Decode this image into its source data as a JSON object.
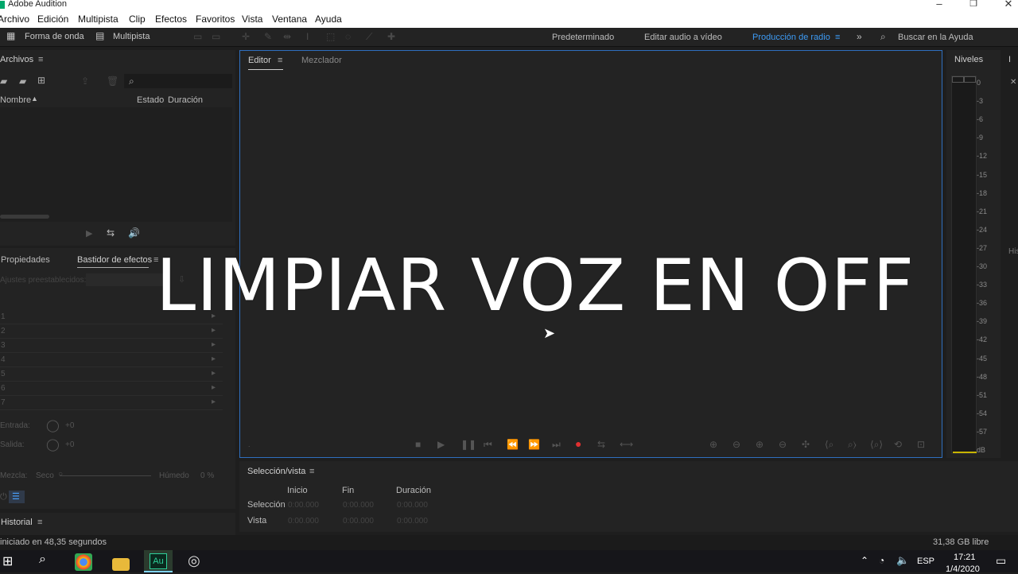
{
  "window": {
    "title": "Adobe Audition"
  },
  "menu": [
    "Archivo",
    "Edición",
    "Multipista",
    "Clip",
    "Efectos",
    "Favoritos",
    "Vista",
    "Ventana",
    "Ayuda"
  ],
  "toolbar": {
    "waveform": "Forma de onda",
    "multitrack": "Multipista",
    "workspaces": [
      "Predeterminado",
      "Editar audio a vídeo",
      "Producción de radio"
    ],
    "search_placeholder": "Buscar en la Ayuda"
  },
  "files_panel": {
    "title": "Archivos",
    "col_name": "Nombre",
    "col_status": "Estado",
    "col_duration": "Duración"
  },
  "effects_panel": {
    "tab_properties": "Propiedades",
    "tab_rack": "Bastidor de efectos",
    "presets_label": "Ajustes preestablecidos:",
    "slots": [
      "1",
      "2",
      "3",
      "4",
      "5",
      "6",
      "7"
    ],
    "input_label": "Entrada:",
    "output_label": "Salida:",
    "input_value": "+0",
    "output_value": "+0",
    "mix_label": "Mezcla:",
    "dry_label": "Seco",
    "wet_label": "Húmedo",
    "mix_value": "0 %"
  },
  "history_panel": {
    "title": "Historial"
  },
  "editor": {
    "tab_editor": "Editor",
    "tab_mixer": "Mezclador"
  },
  "overlay_text": "LIMPIAR VOZ EN OFF",
  "levels": {
    "title": "Niveles",
    "ticks": [
      "0",
      "-3",
      "-6",
      "-9",
      "-12",
      "-15",
      "-18",
      "-21",
      "-24",
      "-27",
      "-30",
      "-33",
      "-36",
      "-39",
      "-42",
      "-45",
      "-48",
      "-51",
      "-54",
      "-57",
      "dB"
    ]
  },
  "selection_panel": {
    "title": "Selección/vista",
    "col_start": "Inicio",
    "col_end": "Fin",
    "col_duration": "Duración",
    "row_selection": "Selección",
    "row_view": "Vista",
    "values": [
      "0:00.000",
      "0:00.000",
      "0:00.000",
      "0:00.000",
      "0:00.000",
      "0:00.000"
    ]
  },
  "status": {
    "left": "iniciado en 48,35 segundos",
    "right": "31,38 GB libre"
  },
  "taskbar": {
    "lang": "ESP",
    "time": "17:21",
    "date": "1/4/2020"
  },
  "colors": {
    "accent": "#3d9bf5",
    "record": "#e03030",
    "panel": "#232323",
    "border_active": "#2f6fbf"
  }
}
